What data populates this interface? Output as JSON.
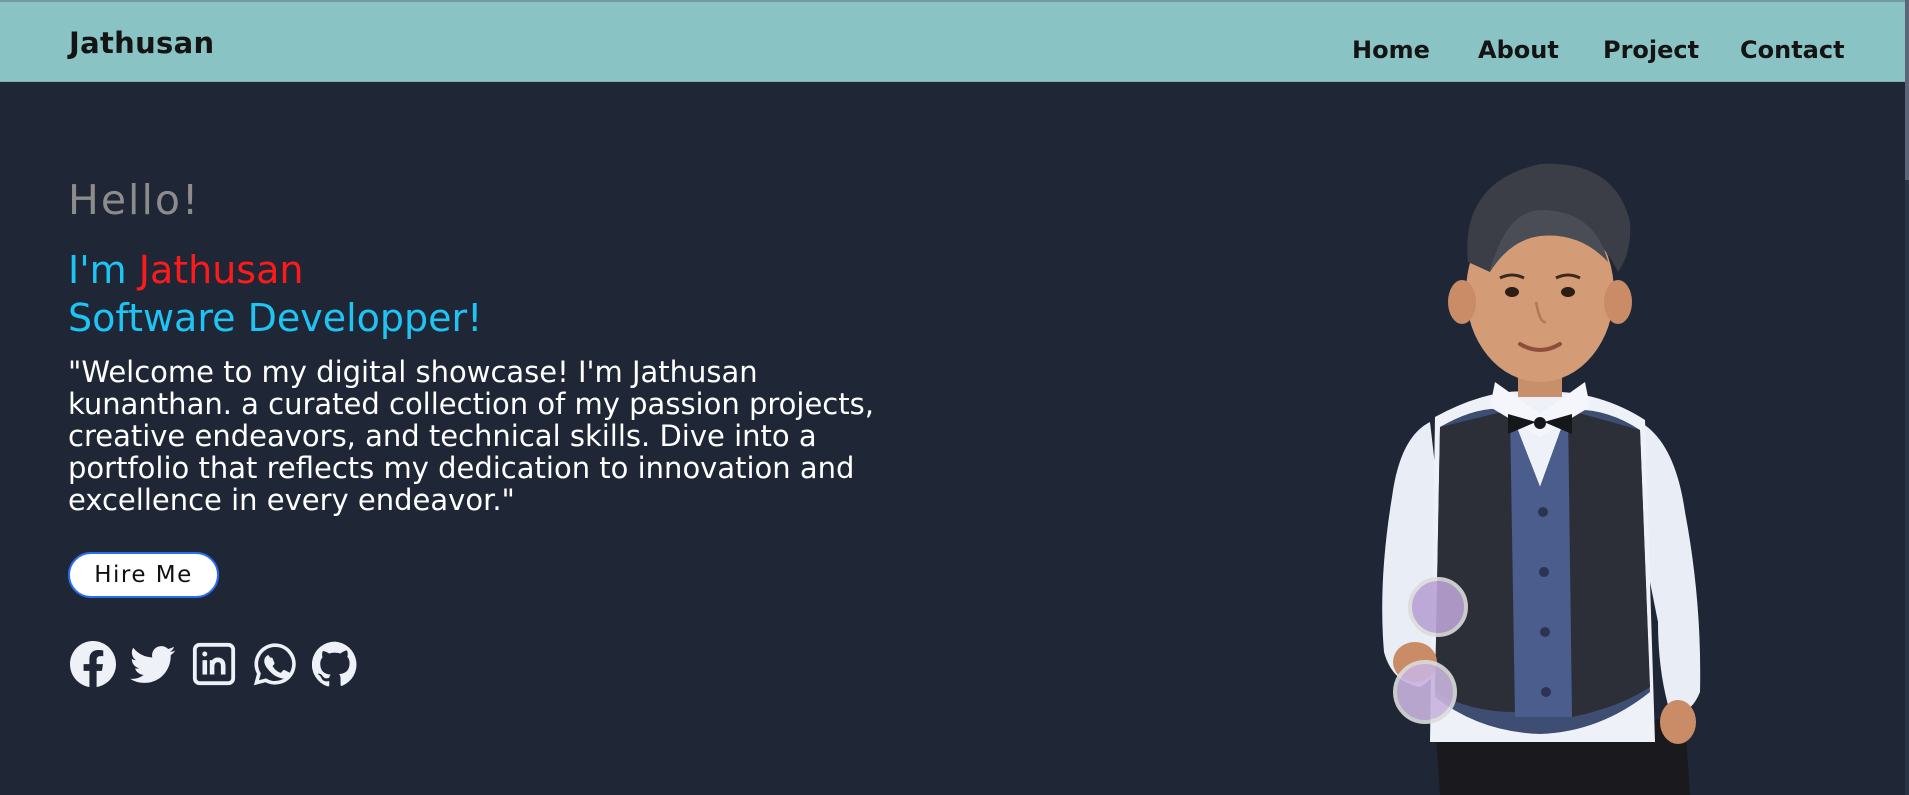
{
  "navbar": {
    "brand": "Jathusan",
    "links": [
      {
        "label": "Home"
      },
      {
        "label": "About"
      },
      {
        "label": "Project"
      },
      {
        "label": "Contact"
      }
    ]
  },
  "hero": {
    "greeting": "Hello!",
    "intro_prefix": "I'm ",
    "intro_name": "Jathusan",
    "role": "Software Developper!",
    "bio": "\"Welcome to my digital showcase! I'm Jathusan kunanthan. a curated collection of my passion projects, creative endeavors, and technical skills. Dive into a portfolio that reflects my dedication to innovation and excellence in every endeavor.\"",
    "cta_label": "Hire Me",
    "socials": [
      {
        "icon": "facebook-icon"
      },
      {
        "icon": "twitter-icon"
      },
      {
        "icon": "linkedin-icon"
      },
      {
        "icon": "whatsapp-icon"
      },
      {
        "icon": "github-icon"
      }
    ],
    "portrait_icon": "profile-photo"
  },
  "colors": {
    "navbar_bg": "#89c3c4",
    "page_bg": "#1f2736",
    "accent_blue": "#1ec4f3",
    "accent_red": "#ff1a1a",
    "greeting_gray": "#8c8c8c",
    "icon_fill": "#eef1f7"
  }
}
